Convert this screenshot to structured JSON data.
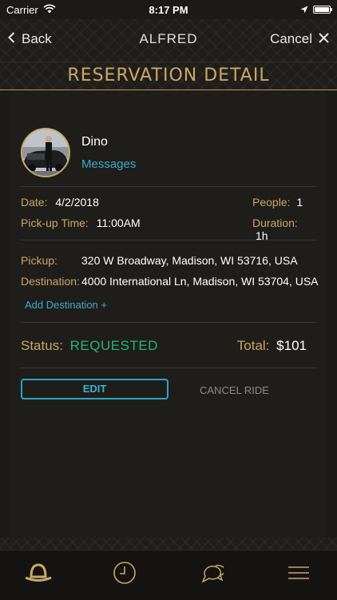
{
  "status_bar": {
    "carrier": "Carrier",
    "time": "8:17 PM"
  },
  "nav": {
    "back_label": "Back",
    "title": "ALFRED",
    "cancel_label": "Cancel"
  },
  "page_title": "RESERVATION DETAIL",
  "profile": {
    "name": "Dino",
    "messages_label": "Messages"
  },
  "details": {
    "date_label": "Date:",
    "date_value": "4/2/2018",
    "pickup_time_label": "Pick-up Time:",
    "pickup_time_value": "11:00AM",
    "people_label": "People:",
    "people_value": "1",
    "duration_label": "Duration:",
    "duration_value": "1h"
  },
  "locations": {
    "pickup_label": "Pickup:",
    "pickup_value": "320 W Broadway, Madison, WI 53716, USA",
    "destination_label": "Destination:",
    "destination_value": "4000 International Ln, Madison, WI 53704, USA",
    "add_destination_label": "Add Destination +"
  },
  "summary": {
    "status_label": "Status:",
    "status_value": "REQUESTED",
    "total_label": "Total:",
    "total_value": "$101"
  },
  "actions": {
    "edit_label": "EDIT",
    "cancel_ride_label": "CANCEL RIDE"
  },
  "tabbar": {
    "tabs": [
      "bowler-hat-icon",
      "clock-icon",
      "chat-bubbles-icon",
      "menu-icon"
    ]
  },
  "colors": {
    "gold": "#c9a868",
    "accent_blue": "#3fa9c9",
    "status_green": "#29b27c",
    "background": "#1b1a17"
  }
}
